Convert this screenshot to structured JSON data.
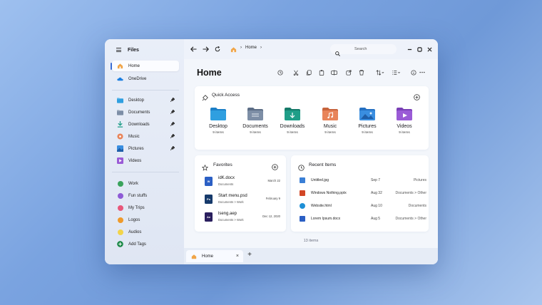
{
  "app": {
    "title": "Files"
  },
  "sidebar": {
    "items": [
      {
        "label": "Home",
        "icon": "home-icon",
        "active": true
      },
      {
        "label": "OneDrive",
        "icon": "onedrive-icon"
      }
    ],
    "pinned": [
      {
        "label": "Desktop",
        "icon": "desktop-folder-icon"
      },
      {
        "label": "Documents",
        "icon": "documents-folder-icon"
      },
      {
        "label": "Downloads",
        "icon": "downloads-folder-icon"
      },
      {
        "label": "Music",
        "icon": "music-folder-icon"
      },
      {
        "label": "Pictures",
        "icon": "pictures-folder-icon"
      },
      {
        "label": "Videos",
        "icon": "videos-folder-icon"
      }
    ],
    "tags": [
      {
        "label": "Work",
        "color": "#3aa35c"
      },
      {
        "label": "Fun stuffs",
        "color": "#8e5bd6"
      },
      {
        "label": "My Trips",
        "color": "#e8577a"
      },
      {
        "label": "Logos",
        "color": "#ef9a2b"
      },
      {
        "label": "Audios",
        "color": "#f2d44a"
      }
    ],
    "add_tags": "Add Tags"
  },
  "topbar": {
    "breadcrumb": "Home",
    "search_placeholder": "Search"
  },
  "page": {
    "title": "Home"
  },
  "quick_access": {
    "title": "Quick Access",
    "items": [
      {
        "name": "Desktop",
        "count": "9 items",
        "color": "#2f9fe0"
      },
      {
        "name": "Documents",
        "count": "9 items",
        "color": "#7d8ea6"
      },
      {
        "name": "Downloads",
        "count": "9 items",
        "color": "#1f9e88"
      },
      {
        "name": "Music",
        "count": "9 items",
        "color": "#e8845a"
      },
      {
        "name": "Pictures",
        "count": "9 items",
        "color": "#3a8ee0"
      },
      {
        "name": "Videos",
        "count": "9 items",
        "color": "#9a5bd6"
      }
    ]
  },
  "favorites": {
    "title": "Favorites",
    "items": [
      {
        "name": "idK.docx",
        "path": "Documents",
        "date": "March 22",
        "badge": "W",
        "color": "#2b5fc4"
      },
      {
        "name": "Start menu.psd",
        "path": "Documents > Work",
        "date": "February 9",
        "badge": "Ps",
        "color": "#163a6b"
      },
      {
        "name": "lseng.aep",
        "path": "Documents > Work",
        "date": "Dec 12, 2020",
        "badge": "Ae",
        "color": "#2a1f5e"
      }
    ]
  },
  "recent": {
    "title": "Recent Items",
    "items": [
      {
        "name": "Untitled.jpg",
        "date": "Sep 7",
        "location": "Pictures",
        "color": "#3a7fd6"
      },
      {
        "name": "Windows Nothing.pptx",
        "date": "Aug 32",
        "location": "Documents > Other",
        "color": "#d24726"
      },
      {
        "name": "Website.html",
        "date": "Aug 10",
        "location": "Documents",
        "color": "#1e8fd6"
      },
      {
        "name": "Lorem Ipsum.docx",
        "date": "Aug 5",
        "location": "Documents > Other",
        "color": "#2b5fc4"
      }
    ]
  },
  "status": {
    "items_count": "13 items"
  },
  "tabs": [
    {
      "label": "Home"
    }
  ]
}
